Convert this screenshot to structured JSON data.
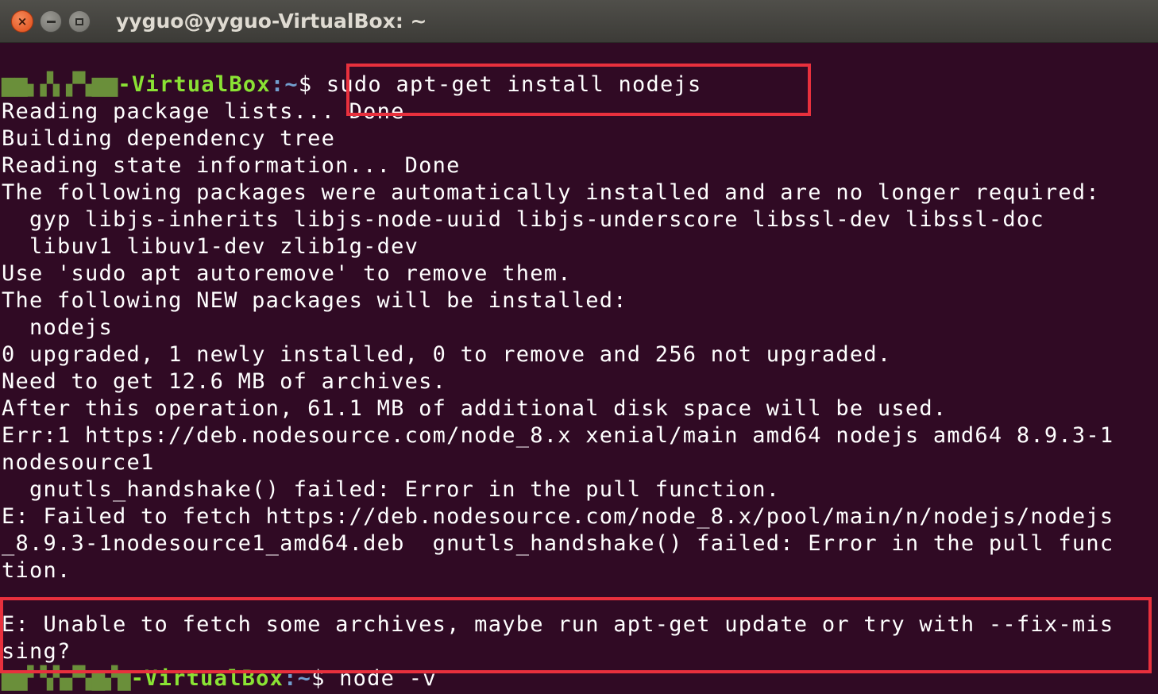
{
  "window": {
    "title": "yyguo@yyguo-VirtualBox: ~",
    "buttons": {
      "close": "×",
      "minimize": "",
      "maximize": ""
    }
  },
  "terminal": {
    "prompt1": {
      "user": "▆▆▖▞▖▞▚▆▆",
      "host": "-VirtualBox",
      "path": ":~",
      "symbol": "$",
      "command": " sudo apt-get install nodejs"
    },
    "lines": [
      "Reading package lists... Done",
      "Building dependency tree",
      "Reading state information... Done",
      "The following packages were automatically installed and are no longer required:",
      "  gyp libjs-inherits libjs-node-uuid libjs-underscore libssl-dev libssl-doc",
      "  libuv1 libuv1-dev zlib1g-dev",
      "Use 'sudo apt autoremove' to remove them.",
      "The following NEW packages will be installed:",
      "  nodejs",
      "0 upgraded, 1 newly installed, 0 to remove and 256 not upgraded.",
      "Need to get 12.6 MB of archives.",
      "After this operation, 61.1 MB of additional disk space will be used.",
      "Err:1 https://deb.nodesource.com/node_8.x xenial/main amd64 nodejs amd64 8.9.3-1",
      "nodesource1",
      "  gnutls_handshake() failed: Error in the pull function.",
      "E: Failed to fetch https://deb.nodesource.com/node_8.x/pool/main/n/nodejs/nodejs",
      "_8.9.3-1nodesource1_amd64.deb  gnutls_handshake() failed: Error in the pull func",
      "tion.",
      "",
      "E: Unable to fetch some archives, maybe run apt-get update or try with --fix-mis",
      "sing?"
    ],
    "prompt2": {
      "user": "▆▆▘▚▚▞▚▆▞▆",
      "host": "-VirtualBox",
      "path": ":~",
      "symbol": "$",
      "command": " node -v"
    }
  },
  "colors": {
    "background": "#300a24",
    "prompt_user": "#8ae234",
    "prompt_path": "#729fcf",
    "highlight": "#e8303d"
  }
}
